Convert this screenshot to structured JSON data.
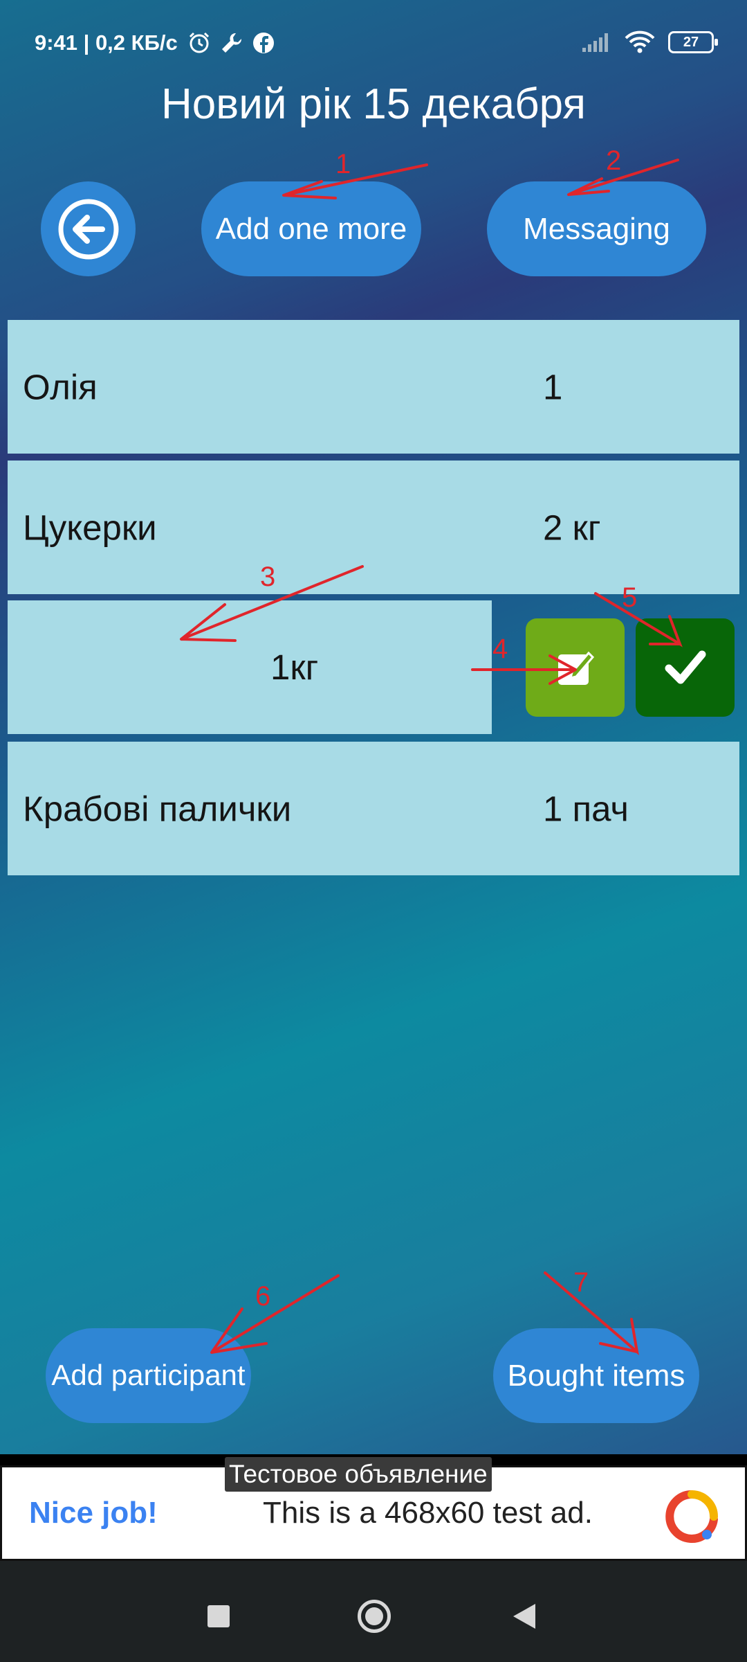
{
  "status_bar": {
    "time_and_speed": "9:41 | 0,2 КБ/с",
    "battery_level": "27",
    "icons": [
      "alarm-icon",
      "wrench-icon",
      "facebook-icon",
      "signal-icon",
      "wifi-icon",
      "battery-icon"
    ]
  },
  "header": {
    "title": "Новий рік 15 декабря"
  },
  "toolbar": {
    "back_icon": "back-arrow-icon",
    "add_more_label": "Add one more",
    "messaging_label": "Messaging"
  },
  "items": [
    {
      "name": "Олія",
      "qty": "1"
    },
    {
      "name": "Цукерки",
      "qty": "2 кг"
    },
    {
      "name": "Крабові палички",
      "qty": "1 пач"
    }
  ],
  "edit_row": {
    "name_value": "",
    "qty_value": "1кг",
    "edit_icon": "edit-icon",
    "confirm_icon": "checkmark-icon"
  },
  "bottom": {
    "add_participant_label": "Add participant",
    "bought_items_label": "Bought items"
  },
  "ad": {
    "label": "Тестовое объявление",
    "headline": "Nice job!",
    "text": "This is a 468x60 test ad."
  },
  "annotations": [
    "1",
    "2",
    "3",
    "4",
    "5",
    "6",
    "7"
  ],
  "colors": {
    "button_blue": "#2f86d4",
    "row_bg": "#a8dbe6",
    "edit_green": "#6fab18",
    "confirm_green": "#086608",
    "annotation_red": "#e0252b"
  }
}
